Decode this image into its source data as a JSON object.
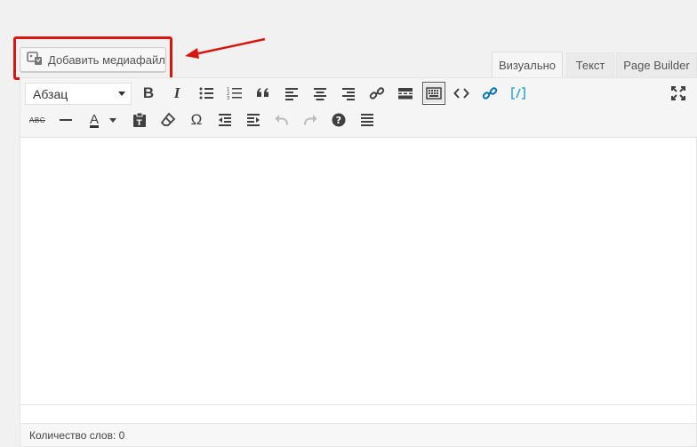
{
  "media_button": {
    "label": "Добавить медиафайл",
    "icon": "add-media-icon"
  },
  "tabs": [
    {
      "label": "Визуально",
      "active": true
    },
    {
      "label": "Текст",
      "active": false
    },
    {
      "label": "Page Builder",
      "active": false
    }
  ],
  "toolbar": {
    "format_select": {
      "value": "Абзац"
    },
    "row1": [
      "bold-icon",
      "italic-icon",
      "bullet-list-icon",
      "numbered-list-icon",
      "blockquote-icon",
      "align-left-icon",
      "align-center-icon",
      "align-right-icon",
      "link-icon",
      "read-more-icon",
      "toolbar-toggle-icon",
      "code-icon",
      "link-alt-icon",
      "shortcode-icon",
      "fullscreen-icon"
    ],
    "row2": [
      "strikethrough-icon",
      "horizontal-line-icon",
      "text-color-icon",
      "paste-text-icon",
      "clear-formatting-icon",
      "special-character-icon",
      "outdent-icon",
      "indent-icon",
      "undo-icon",
      "redo-icon",
      "help-icon",
      "justify-icon"
    ],
    "bold_label": "B",
    "italic_label": "I",
    "text_color_label": "A",
    "omega_label": "Ω",
    "strike_label": "ABC"
  },
  "status": {
    "word_count": "Количество слов: 0"
  },
  "colors": {
    "highlight": "#d9150f",
    "accent": "#0073aa",
    "shortcode": "#35a8d2"
  }
}
